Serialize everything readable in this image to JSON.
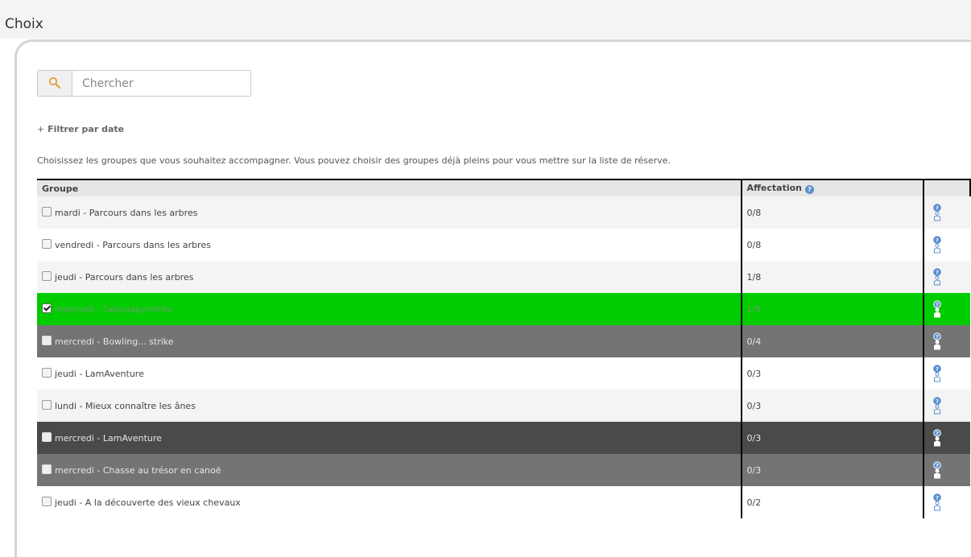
{
  "page": {
    "title": "Choix"
  },
  "search": {
    "placeholder": "Chercher",
    "value": ""
  },
  "filter": {
    "plus": "+",
    "label": "Filtrer par date"
  },
  "instructions": "Choisissez les groupes que vous souhaitez accompagner. Vous pouvez choisir des groupes déjà pleins pour vous mettre sur la liste de réserve.",
  "table": {
    "headers": {
      "group": "Groupe",
      "affectation": "Affectation",
      "actions": ""
    },
    "rows": [
      {
        "label": "mardi - Parcours dans les arbres",
        "affectation": "0/8",
        "checked": false,
        "style": "light"
      },
      {
        "label": "vendredi - Parcours dans les arbres",
        "affectation": "0/8",
        "checked": false,
        "style": "white"
      },
      {
        "label": "jeudi - Parcours dans les arbres",
        "affectation": "1/8",
        "checked": false,
        "style": "light"
      },
      {
        "label": "mercredi - Swisslabyrinthe",
        "affectation": "1/5",
        "checked": true,
        "style": "green"
      },
      {
        "label": "mercredi - Bowling... strike",
        "affectation": "0/4",
        "checked": false,
        "style": "gray"
      },
      {
        "label": "jeudi - LamAventure",
        "affectation": "0/3",
        "checked": false,
        "style": "white"
      },
      {
        "label": "lundi - Mieux connaître les ânes",
        "affectation": "0/3",
        "checked": false,
        "style": "light"
      },
      {
        "label": "mercredi - LamAventure",
        "affectation": "0/3",
        "checked": false,
        "style": "dark"
      },
      {
        "label": "mercredi - Chasse au trésor en canoë",
        "affectation": "0/3",
        "checked": false,
        "style": "gray"
      },
      {
        "label": "jeudi - A la découverte des vieux chevaux",
        "affectation": "0/2",
        "checked": false,
        "style": "white"
      }
    ]
  },
  "icons": {
    "search": "search-icon",
    "help": "help-icon",
    "person": "person-info-icon"
  },
  "colors": {
    "selected_row": "#00cc00",
    "full_row": "#747474",
    "full_row_dark": "#4a4a4a",
    "search_icon": "#e0a040",
    "info_icon": "#5b8fd0"
  }
}
